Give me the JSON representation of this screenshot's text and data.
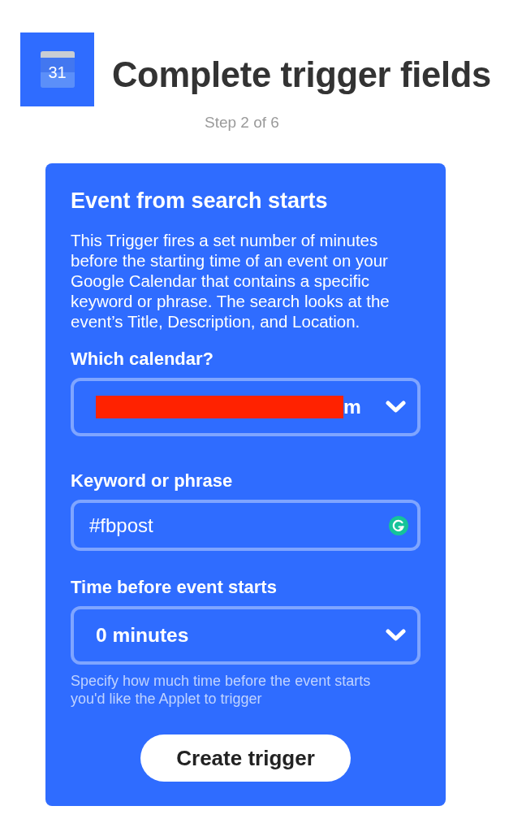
{
  "header": {
    "logo_day": "31",
    "title": "Complete trigger fields",
    "step": "Step 2 of 6"
  },
  "card": {
    "title": "Event from search starts",
    "description": "This Trigger fires a set number of minutes before the starting time of an event on your Google Calendar that contains a specific keyword or phrase. The search looks at the event’s Title, Description, and Location.",
    "fields": [
      {
        "kind": "select",
        "label": "Which calendar?",
        "value": "m",
        "redacted": true
      },
      {
        "kind": "text",
        "label": "Keyword or phrase",
        "value": "#fbpost",
        "assistant_badge": true
      },
      {
        "kind": "select",
        "label": "Time before event starts",
        "value": "0 minutes",
        "hint": "Specify how much time before the event starts you'd like the Applet to trigger"
      }
    ],
    "button": "Create trigger"
  }
}
